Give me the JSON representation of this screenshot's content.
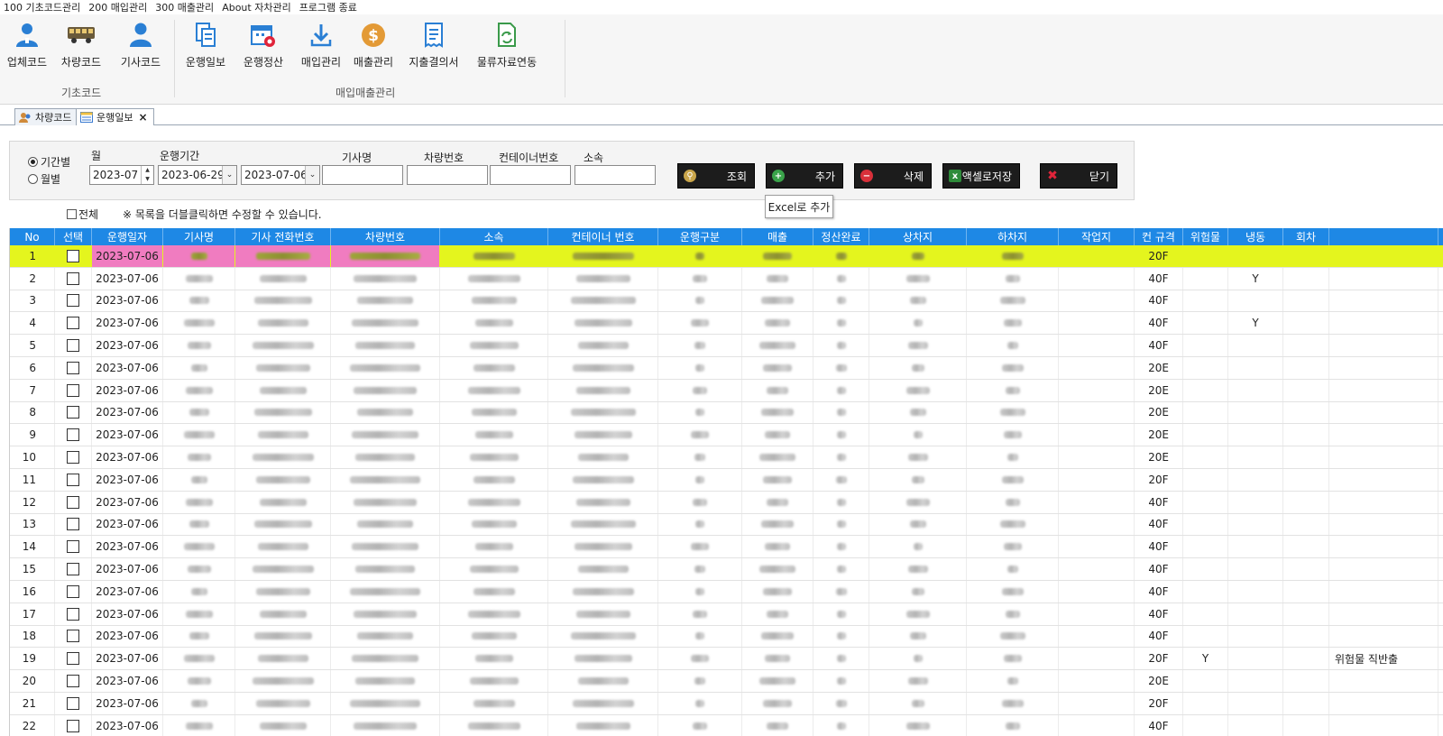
{
  "menubar": [
    "100 기초코드관리",
    "200 매입관리",
    "300 매출관리",
    "About 자차관리",
    "프로그램 종료"
  ],
  "ribbon": {
    "group1_label": "기초코드",
    "group2_label": "매입매출관리",
    "buttons": [
      {
        "label": "업체코드",
        "icon": "company-person-icon"
      },
      {
        "label": "차량코드",
        "icon": "truck-icon"
      },
      {
        "label": "기사코드",
        "icon": "driver-person-icon"
      },
      {
        "label": "운행일보",
        "icon": "document-copy-icon"
      },
      {
        "label": "운행정산",
        "icon": "calendar-settle-icon"
      },
      {
        "label": "매입관리",
        "icon": "download-arrow-icon"
      },
      {
        "label": "매출관리",
        "icon": "dollar-coin-icon"
      },
      {
        "label": "지출결의서",
        "icon": "receipt-icon"
      },
      {
        "label": "물류자료연동",
        "icon": "sync-document-icon"
      }
    ]
  },
  "tabs": [
    {
      "label": "차량코드",
      "icon": "people-icon",
      "active": false
    },
    {
      "label": "운행일보",
      "icon": "grid-form-icon",
      "active": true,
      "close": "×"
    }
  ],
  "filter": {
    "radio_period": "기간별",
    "radio_month": "월별",
    "month_label": "월",
    "month_value": "2023-07",
    "period_label": "운행기간",
    "period_from": "2023-06-29",
    "period_to": "2023-07-06",
    "driver_label": "기사명",
    "vehicle_label": "차량번호",
    "container_label": "컨테이너번호",
    "affiliation_label": "소속",
    "all_label": "전체",
    "hint": "※ 목록을 더블클릭하면 수정할 수 있습니다."
  },
  "actions": {
    "search": "조회",
    "add": "추가",
    "delete": "삭제",
    "excel_save": "액셀로저장",
    "close": "닫기",
    "tooltip": "Excel로 추가"
  },
  "colors": {
    "grid_header": "#1e88e5",
    "selected_row": "#e4f51e",
    "highlight_cell": "#f07cc0"
  },
  "grid": {
    "columns": [
      "No",
      "선택",
      "운행일자",
      "기사명",
      "기사 전화번호",
      "차량번호",
      "소속",
      "컨테이너 번호",
      "운행구분",
      "매출",
      "정산완료",
      "상차지",
      "하차지",
      "작업지",
      "컨 규격",
      "위험물",
      "냉동",
      "회차",
      ""
    ],
    "rows": [
      {
        "no": "1",
        "date": "2023-07-06",
        "size": "20F",
        "danger": "",
        "frozen": "",
        "note": ""
      },
      {
        "no": "2",
        "date": "2023-07-06",
        "size": "40F",
        "danger": "",
        "frozen": "Y",
        "note": ""
      },
      {
        "no": "3",
        "date": "2023-07-06",
        "size": "40F",
        "danger": "",
        "frozen": "",
        "note": ""
      },
      {
        "no": "4",
        "date": "2023-07-06",
        "size": "40F",
        "danger": "",
        "frozen": "Y",
        "note": ""
      },
      {
        "no": "5",
        "date": "2023-07-06",
        "size": "40F",
        "danger": "",
        "frozen": "",
        "note": ""
      },
      {
        "no": "6",
        "date": "2023-07-06",
        "size": "20E",
        "danger": "",
        "frozen": "",
        "note": ""
      },
      {
        "no": "7",
        "date": "2023-07-06",
        "size": "20E",
        "danger": "",
        "frozen": "",
        "note": ""
      },
      {
        "no": "8",
        "date": "2023-07-06",
        "size": "20E",
        "danger": "",
        "frozen": "",
        "note": ""
      },
      {
        "no": "9",
        "date": "2023-07-06",
        "size": "20E",
        "danger": "",
        "frozen": "",
        "note": ""
      },
      {
        "no": "10",
        "date": "2023-07-06",
        "size": "20E",
        "danger": "",
        "frozen": "",
        "note": ""
      },
      {
        "no": "11",
        "date": "2023-07-06",
        "size": "20F",
        "danger": "",
        "frozen": "",
        "note": ""
      },
      {
        "no": "12",
        "date": "2023-07-06",
        "size": "40F",
        "danger": "",
        "frozen": "",
        "note": ""
      },
      {
        "no": "13",
        "date": "2023-07-06",
        "size": "40F",
        "danger": "",
        "frozen": "",
        "note": ""
      },
      {
        "no": "14",
        "date": "2023-07-06",
        "size": "40F",
        "danger": "",
        "frozen": "",
        "note": ""
      },
      {
        "no": "15",
        "date": "2023-07-06",
        "size": "40F",
        "danger": "",
        "frozen": "",
        "note": ""
      },
      {
        "no": "16",
        "date": "2023-07-06",
        "size": "40F",
        "danger": "",
        "frozen": "",
        "note": ""
      },
      {
        "no": "17",
        "date": "2023-07-06",
        "size": "40F",
        "danger": "",
        "frozen": "",
        "note": ""
      },
      {
        "no": "18",
        "date": "2023-07-06",
        "size": "40F",
        "danger": "",
        "frozen": "",
        "note": ""
      },
      {
        "no": "19",
        "date": "2023-07-06",
        "size": "20F",
        "danger": "Y",
        "frozen": "",
        "note": "위험물 직반출"
      },
      {
        "no": "20",
        "date": "2023-07-06",
        "size": "20E",
        "danger": "",
        "frozen": "",
        "note": ""
      },
      {
        "no": "21",
        "date": "2023-07-06",
        "size": "20F",
        "danger": "",
        "frozen": "",
        "note": ""
      },
      {
        "no": "22",
        "date": "2023-07-06",
        "size": "40F",
        "danger": "",
        "frozen": "",
        "note": ""
      }
    ]
  }
}
